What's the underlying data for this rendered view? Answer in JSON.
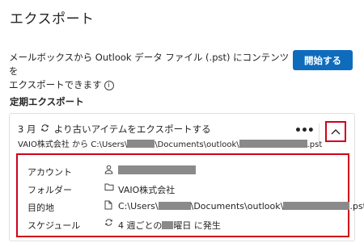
{
  "page_title": "エクスポート",
  "description": {
    "line1": "メールボックスから Outlook データ ファイル (.pst) にコンテンツを",
    "line2": "エクスポートできます",
    "info_icon": "i"
  },
  "start_button_label": "開始する",
  "section_title": "定期エクスポート",
  "card": {
    "title_prefix": "3 月",
    "title_suffix": "より古いアイテムをエクスポートする",
    "sub_prefix": "VAIO株式会社 から C:\\Users\\",
    "sub_mid": "\\Documents\\outlook\\",
    "sub_suffix": ".pst",
    "more_label": "•••"
  },
  "details": {
    "account_label": "アカウント",
    "folder_label": "フォルダー",
    "folder_value": "VAIO株式会社",
    "destination_label": "目的地",
    "destination_prefix": "C:\\Users\\",
    "destination_mid": "\\Documents\\outlook\\",
    "destination_suffix": ".pst",
    "schedule_label": "スケジュール",
    "schedule_prefix": "4 週ごとの",
    "schedule_suffix": "曜日 に発生"
  },
  "colors": {
    "accent": "#0f6cbd",
    "highlight_border": "#d0021b",
    "redaction": "#8a8a8a"
  },
  "icons": [
    "info-icon",
    "sync-icon",
    "more-icon",
    "chevron-up-icon",
    "person-icon",
    "folder-icon",
    "repeat-icon"
  ]
}
